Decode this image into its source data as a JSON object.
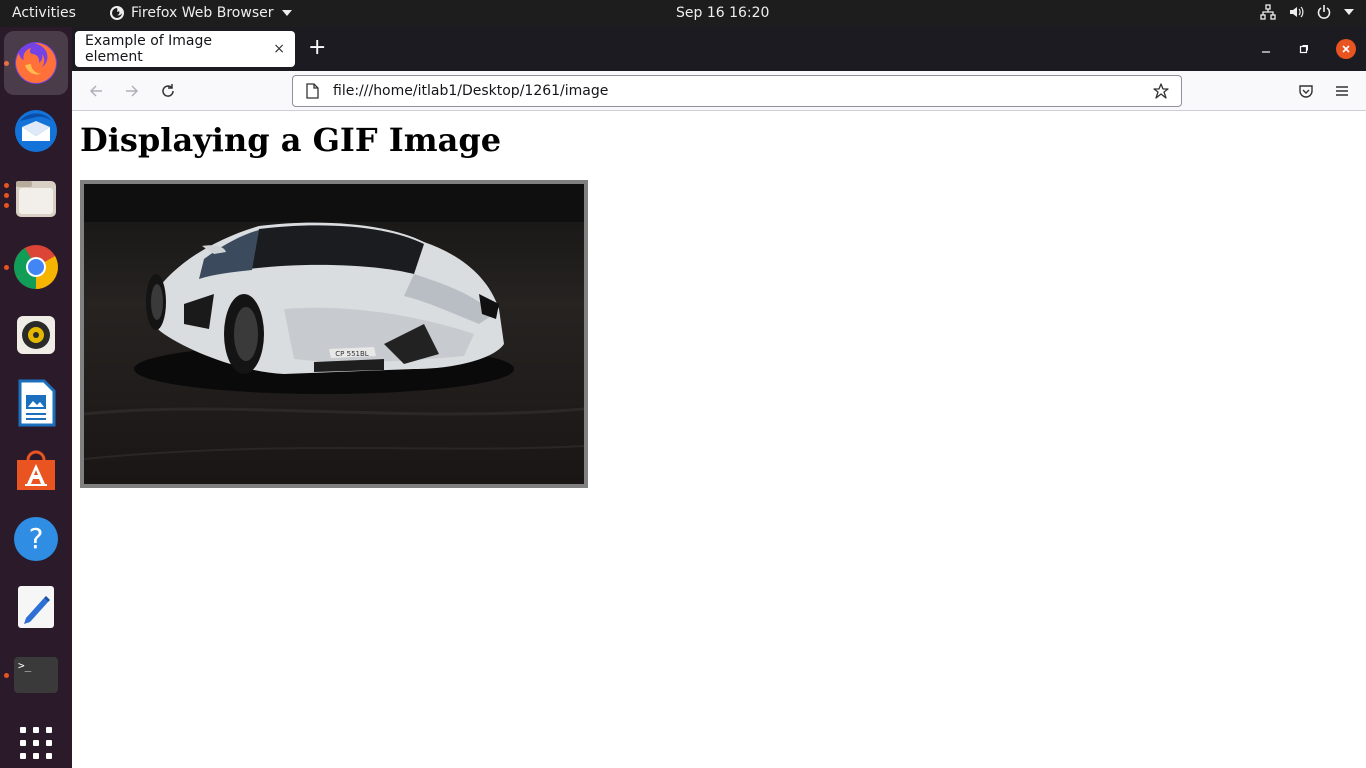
{
  "topbar": {
    "activities": "Activities",
    "app_name": "Firefox Web Browser",
    "clock": "Sep 16  16:20",
    "icons": [
      "network-icon",
      "volume-icon",
      "power-icon",
      "menu-down-icon"
    ]
  },
  "dock": {
    "items": [
      {
        "name": "firefox-icon",
        "running": true,
        "active": true
      },
      {
        "name": "thunderbird-icon",
        "running": false
      },
      {
        "name": "files-icon",
        "running": true
      },
      {
        "name": "chrome-icon",
        "running": true
      },
      {
        "name": "rhythmbox-icon",
        "running": false
      },
      {
        "name": "writer-icon",
        "running": false
      },
      {
        "name": "software-icon",
        "running": false
      },
      {
        "name": "help-icon",
        "running": false
      },
      {
        "name": "text-editor-icon",
        "running": false
      },
      {
        "name": "terminal-icon",
        "running": true
      },
      {
        "name": "app-grid-icon",
        "running": false
      }
    ],
    "terminal_prompt": ">_"
  },
  "browser": {
    "tab_title": "Example of Image element",
    "tab_close": "×",
    "new_tab": "+",
    "url": "file:///home/itlab1/Desktop/1261/image"
  },
  "page": {
    "heading": "Displaying a GIF Image",
    "plate_text": "CP 551BL"
  },
  "colors": {
    "accent": "#e95420",
    "dock_bg": "#2b1a2a",
    "topbar_bg": "#1d1d1d",
    "tabbar_bg": "#1c1b22"
  }
}
